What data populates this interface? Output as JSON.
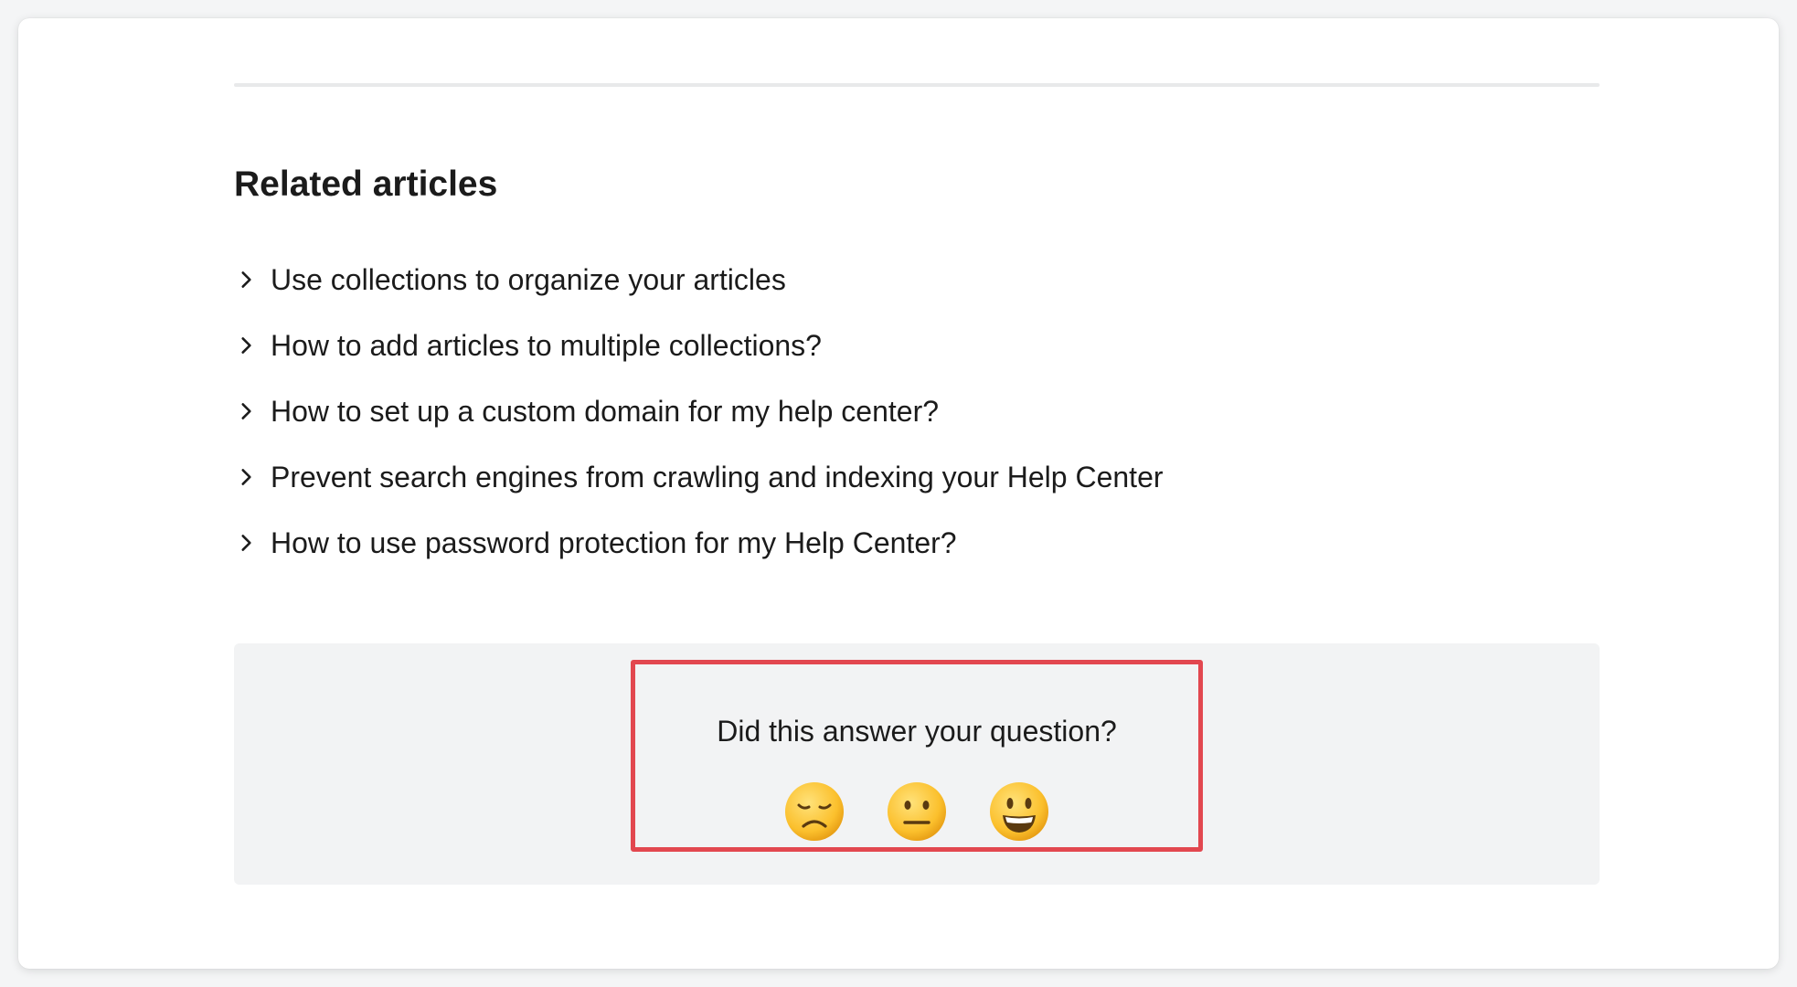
{
  "related": {
    "title": "Related articles",
    "articles": [
      {
        "label": "Use collections to organize your articles"
      },
      {
        "label": "How to add articles to multiple collections?"
      },
      {
        "label": "How to set up a custom domain for my help center?"
      },
      {
        "label": "Prevent search engines from crawling and indexing your Help Center"
      },
      {
        "label": "How to use password protection for my Help Center?"
      }
    ]
  },
  "feedback": {
    "question": "Did this answer your question?",
    "reactions": [
      {
        "icon": "disappointed-face-icon"
      },
      {
        "icon": "neutral-face-icon"
      },
      {
        "icon": "smiley-face-icon"
      }
    ],
    "highlight_color": "#e2474f"
  },
  "colors": {
    "text": "#1b1b1b",
    "panel_bg": "#f2f3f4",
    "divider": "#e8e9ea"
  }
}
